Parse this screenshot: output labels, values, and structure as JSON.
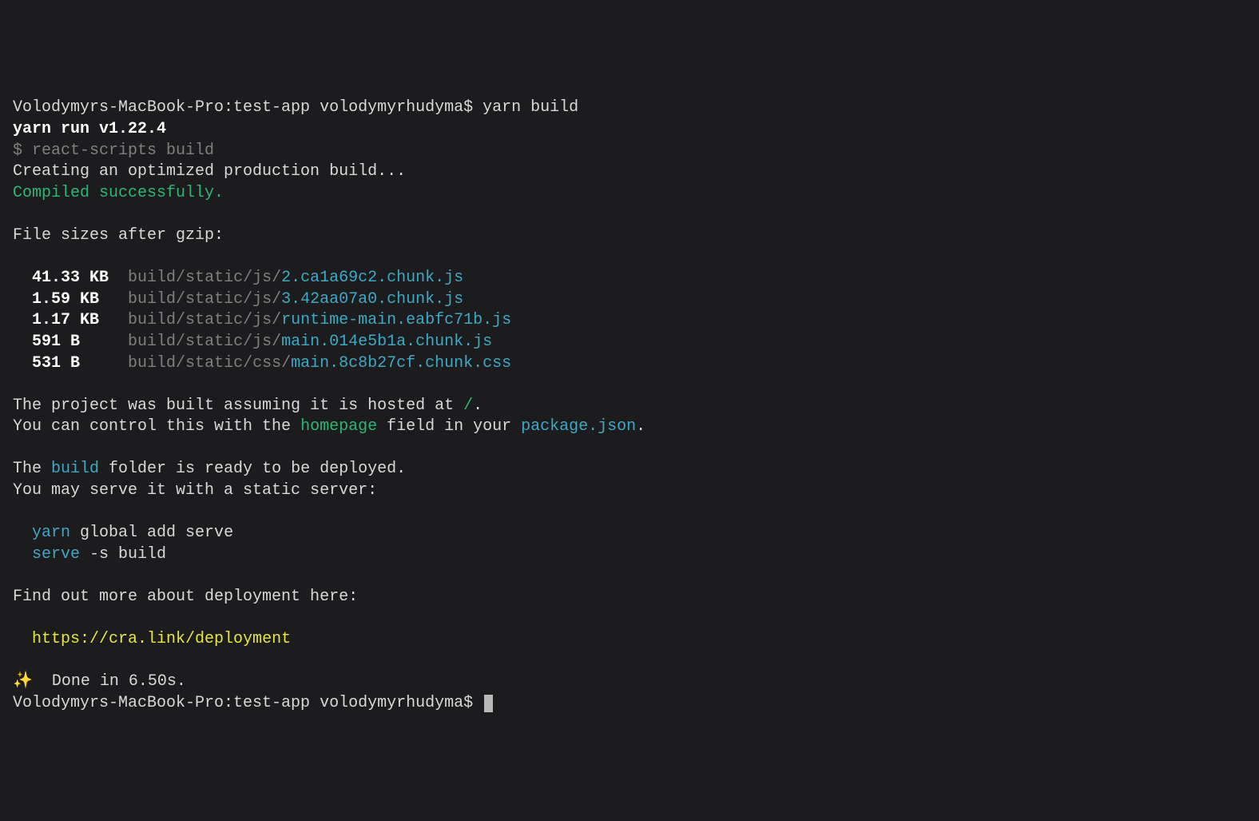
{
  "prompt1": {
    "host_path": "Volodymyrs-MacBook-Pro:test-app volodymyrhudyma$ ",
    "command": "yarn build"
  },
  "yarn_run": "yarn run v1.22.4",
  "script_line": {
    "prefix": "$ ",
    "cmd": "react-scripts build"
  },
  "creating": "Creating an optimized production build...",
  "compiled": "Compiled successfully.",
  "sizes_header": "File sizes after gzip:",
  "files": [
    {
      "size": "41.33 KB",
      "dir": "build/static/js/",
      "name": "2.ca1a69c2.chunk.js"
    },
    {
      "size": "1.59 KB",
      "dir": "build/static/js/",
      "name": "3.42aa07a0.chunk.js"
    },
    {
      "size": "1.17 KB",
      "dir": "build/static/js/",
      "name": "runtime-main.eabfc71b.js"
    },
    {
      "size": "591 B",
      "dir": "build/static/js/",
      "name": "main.014e5b1a.chunk.js"
    },
    {
      "size": "531 B",
      "dir": "build/static/css/",
      "name": "main.8c8b27cf.chunk.css"
    }
  ],
  "hosted": {
    "l1a": "The project was built assuming it is hosted at ",
    "l1b": "/",
    "l1c": ".",
    "l2a": "You can control this with the ",
    "l2b": "homepage",
    "l2c": " field in your ",
    "l2d": "package.json",
    "l2e": "."
  },
  "ready": {
    "l1a": "The ",
    "l1b": "build",
    "l1c": " folder is ready to be deployed.",
    "l2": "You may serve it with a static server:"
  },
  "serve": {
    "l1a": "yarn",
    "l1b": " global add serve",
    "l2a": "serve",
    "l2b": " -s build"
  },
  "deploy_more": "Find out more about deployment here:",
  "deploy_url": "https://cra.link/deployment",
  "done": {
    "emoji": "✨",
    "text": "  Done in 6.50s."
  },
  "prompt2": "Volodymyrs-MacBook-Pro:test-app volodymyrhudyma$ "
}
